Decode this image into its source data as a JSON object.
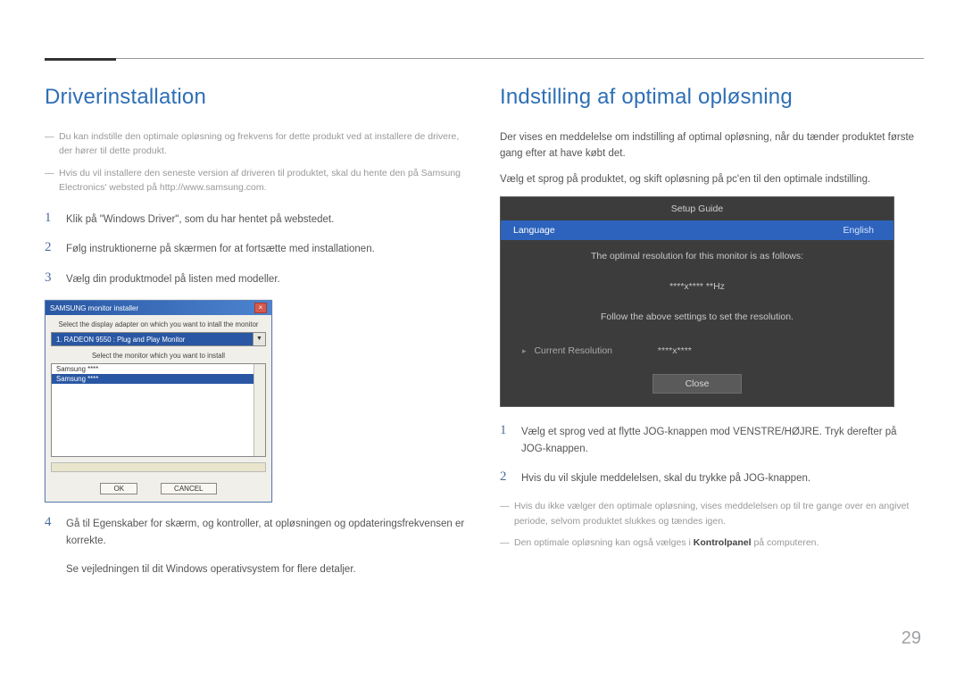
{
  "header": {},
  "left": {
    "heading": "Driverinstallation",
    "note1": "Du kan indstille den optimale opløsning og frekvens for dette produkt ved at installere de drivere, der hører til dette produkt.",
    "note2": "Hvis du vil installere den seneste version af driveren til produktet, skal du hente den på Samsung Electronics' websted på http://www.samsung.com.",
    "steps": {
      "s1": "Klik på \"Windows Driver\", som du har hentet på webstedet.",
      "s2": "Følg instruktionerne på skærmen for at fortsætte med installationen.",
      "s3": "Vælg din produktmodel på listen med modeller.",
      "s4": "Gå til Egenskaber for skærm, og kontroller, at opløsningen og opdateringsfrekvensen er korrekte."
    },
    "s4_sub": "Se vejledningen til dit Windows operativsystem for flere detaljer.",
    "dialog": {
      "title": "SAMSUNG monitor installer",
      "section1": "Select the display adapter on which you want to intall the monitor",
      "adapter": "1. RADEON 9550 : Plug and Play Monitor",
      "section2": "Select the monitor which you want to install",
      "list0": "Samsung ****",
      "list1": "Samsung ****",
      "ok": "OK",
      "cancel": "CANCEL"
    }
  },
  "right": {
    "heading": "Indstilling af optimal opløsning",
    "p1": "Der vises en meddelelse om indstilling af optimal opløsning, når du tænder produktet første gang efter at have købt det.",
    "p2": "Vælg et sprog på produktet, og skift opløsning på pc'en til den optimale indstilling.",
    "osd": {
      "title": "Setup Guide",
      "lang_label": "Language",
      "lang_value": "English",
      "line1": "The optimal resolution for this monitor is as follows:",
      "res": "****x**** **Hz",
      "line2": "Follow the above settings to set the resolution.",
      "current_label": "Current Resolution",
      "current_value": "****x****",
      "close": "Close"
    },
    "steps": {
      "s1": "Vælg et sprog ved at flytte JOG-knappen mod VENSTRE/HØJRE. Tryk derefter på JOG-knappen.",
      "s2": "Hvis du vil skjule meddelelsen, skal du trykke på JOG-knappen."
    },
    "note1": "Hvis du ikke vælger den optimale opløsning, vises meddelelsen op til tre gange over en angivet periode, selvom produktet slukkes og tændes igen.",
    "note2_pre": "Den optimale opløsning kan også vælges i ",
    "note2_bold": "Kontrolpanel",
    "note2_post": " på computeren."
  },
  "page_number": "29"
}
